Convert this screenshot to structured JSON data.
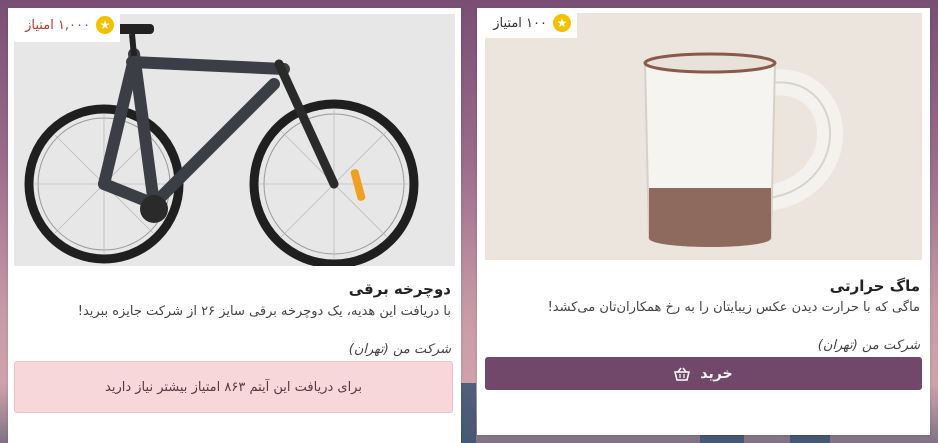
{
  "cards": [
    {
      "points": "۱,۰۰۰ امتیاز",
      "title": "دوچرخه برقی",
      "description": "با دریافت این هدیه، یک دوچرخه برقی سایز ۲۶ از شرکت جایزه ببرید!",
      "company": "شرکت من (تهران)",
      "warning": "برای دریافت این آیتم ۸۶۳ امتیاز بیشتر نیاز دارید"
    },
    {
      "points": "۱۰۰ امتیاز",
      "title": "ماگ حرارتی",
      "description": "ماگی که با حرارت دیدن عکس زیبایتان را به رخ همکاران‌تان می‌کشد!",
      "company": "شرکت من (تهران)",
      "button_label": "خرید"
    }
  ],
  "icons": {
    "points": "star-icon",
    "buy": "basket-icon"
  },
  "colors": {
    "primary": "#71476a",
    "star": "#f2c200",
    "warning_bg": "#f8d7da",
    "points_red": "#c0392b"
  }
}
